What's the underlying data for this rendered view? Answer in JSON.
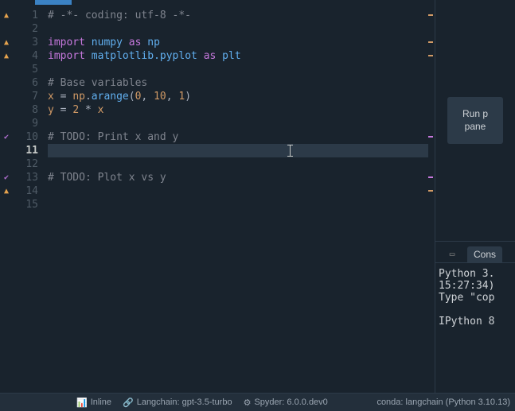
{
  "editor": {
    "lines": [
      {
        "n": 1,
        "marker": "warn",
        "tokens": [
          {
            "t": "# -*- coding: utf-8 -*-",
            "c": "tok-comment"
          }
        ],
        "edge": "orange"
      },
      {
        "n": 2,
        "marker": "",
        "tokens": []
      },
      {
        "n": 3,
        "marker": "warn",
        "tokens": [
          {
            "t": "import",
            "c": "tok-keyword"
          },
          {
            "t": " ",
            "c": ""
          },
          {
            "t": "numpy",
            "c": "tok-module2"
          },
          {
            "t": " ",
            "c": ""
          },
          {
            "t": "as",
            "c": "tok-keyword"
          },
          {
            "t": " ",
            "c": ""
          },
          {
            "t": "np",
            "c": "tok-module2"
          }
        ],
        "edge": "orange"
      },
      {
        "n": 4,
        "marker": "warn",
        "tokens": [
          {
            "t": "import",
            "c": "tok-keyword"
          },
          {
            "t": " ",
            "c": ""
          },
          {
            "t": "matplotlib.pyplot",
            "c": "tok-module2"
          },
          {
            "t": " ",
            "c": ""
          },
          {
            "t": "as",
            "c": "tok-keyword"
          },
          {
            "t": " ",
            "c": ""
          },
          {
            "t": "plt",
            "c": "tok-module2"
          }
        ],
        "edge": "orange"
      },
      {
        "n": 5,
        "marker": "",
        "tokens": []
      },
      {
        "n": 6,
        "marker": "",
        "tokens": [
          {
            "t": "# Base variables",
            "c": "tok-comment"
          }
        ]
      },
      {
        "n": 7,
        "marker": "",
        "tokens": [
          {
            "t": "x",
            "c": "tok-ident"
          },
          {
            "t": " ",
            "c": ""
          },
          {
            "t": "=",
            "c": "tok-op"
          },
          {
            "t": " ",
            "c": ""
          },
          {
            "t": "np",
            "c": "tok-ident"
          },
          {
            "t": ".",
            "c": "tok-op"
          },
          {
            "t": "arange",
            "c": "tok-func"
          },
          {
            "t": "(",
            "c": "tok-op"
          },
          {
            "t": "0",
            "c": "tok-num"
          },
          {
            "t": ", ",
            "c": "tok-op"
          },
          {
            "t": "10",
            "c": "tok-num"
          },
          {
            "t": ", ",
            "c": "tok-op"
          },
          {
            "t": "1",
            "c": "tok-num"
          },
          {
            "t": ")",
            "c": "tok-op"
          }
        ]
      },
      {
        "n": 8,
        "marker": "",
        "tokens": [
          {
            "t": "y",
            "c": "tok-ident"
          },
          {
            "t": " ",
            "c": ""
          },
          {
            "t": "=",
            "c": "tok-op"
          },
          {
            "t": " ",
            "c": ""
          },
          {
            "t": "2",
            "c": "tok-num"
          },
          {
            "t": " ",
            "c": ""
          },
          {
            "t": "*",
            "c": "tok-op"
          },
          {
            "t": " ",
            "c": ""
          },
          {
            "t": "x",
            "c": "tok-ident"
          }
        ]
      },
      {
        "n": 9,
        "marker": "",
        "tokens": []
      },
      {
        "n": 10,
        "marker": "check",
        "tokens": [
          {
            "t": "# TODO: Print x and y",
            "c": "tok-comment"
          }
        ],
        "edge": "purple"
      },
      {
        "n": 11,
        "marker": "",
        "tokens": [],
        "current": true
      },
      {
        "n": 12,
        "marker": "",
        "tokens": []
      },
      {
        "n": 13,
        "marker": "check",
        "tokens": [
          {
            "t": "# TODO: Plot x vs y",
            "c": "tok-comment"
          }
        ],
        "edge": "purple"
      },
      {
        "n": 14,
        "marker": "warn",
        "tokens": [],
        "edge": "orange"
      },
      {
        "n": 15,
        "marker": "",
        "tokens": []
      }
    ],
    "current_line": 11
  },
  "right": {
    "run_button": "Run previous cell and advance (click below this panel)",
    "run_button_short1": "Run p",
    "run_button_short2": "pane"
  },
  "console": {
    "tab_label": "Cons",
    "body_line1": "Python 3.",
    "body_line2": "15:27:34)",
    "body_line3": "Type \"cop",
    "body_line4": "",
    "body_line5": "IPython 8"
  },
  "status": {
    "inline": "Inline",
    "langchain": "Langchain: gpt-3.5-turbo",
    "spyder": "Spyder: 6.0.0.dev0",
    "conda": "conda: langchain (Python 3.10.13)"
  }
}
